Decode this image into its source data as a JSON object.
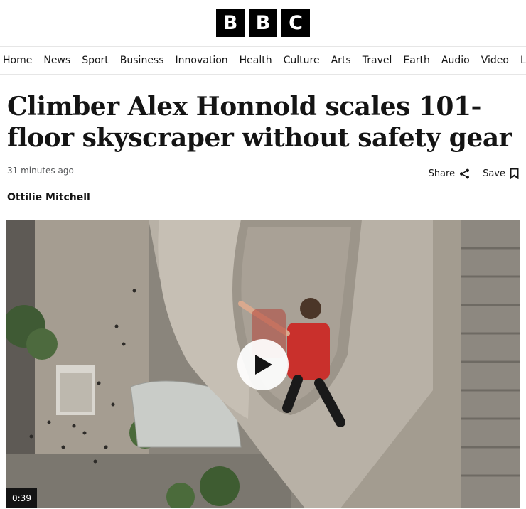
{
  "brand": {
    "letters": [
      "B",
      "B",
      "C"
    ]
  },
  "nav": {
    "items": [
      "Home",
      "News",
      "Sport",
      "Business",
      "Innovation",
      "Health",
      "Culture",
      "Arts",
      "Travel",
      "Earth",
      "Audio",
      "Video",
      "Live"
    ]
  },
  "article": {
    "headline": "Climber Alex Honnold scales 101-floor skyscraper without safety gear",
    "timestamp": "31 minutes ago",
    "author": "Ottilie Mitchell",
    "share_label": "Share",
    "save_label": "Save"
  },
  "video": {
    "duration": "0:39"
  },
  "icons": {
    "share": "share-icon",
    "save": "bookmark-icon",
    "play": "play-icon"
  }
}
